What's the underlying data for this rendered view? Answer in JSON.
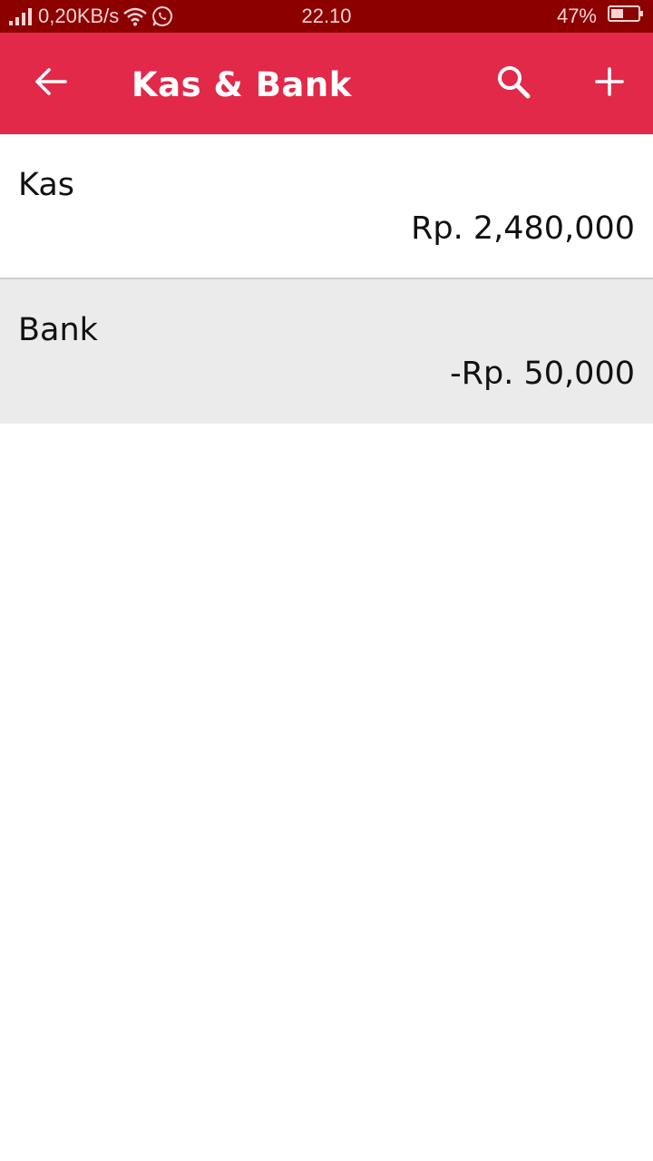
{
  "status_bar": {
    "network_speed": "0,20KB/s",
    "time": "22.10",
    "battery_percent": "47%",
    "icons": [
      "signal-icon",
      "wifi-icon",
      "whatsapp-icon",
      "battery-icon"
    ]
  },
  "app_bar": {
    "title": "Kas & Bank",
    "background_color": "#e2294a",
    "icons": [
      "back-arrow-icon",
      "search-icon",
      "plus-icon"
    ]
  },
  "accounts": [
    {
      "name": "Kas",
      "amount": "Rp. 2,480,000"
    },
    {
      "name": "Bank",
      "amount": "-Rp. 50,000"
    }
  ]
}
